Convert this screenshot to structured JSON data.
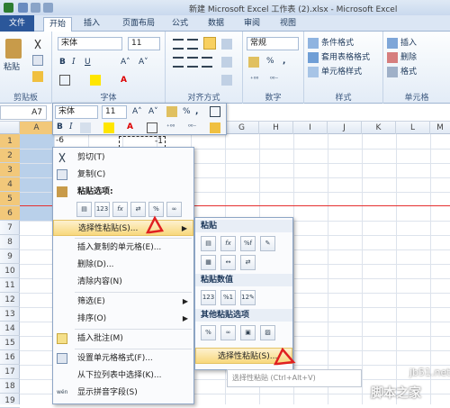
{
  "title": "新建 Microsoft Excel 工作表 (2).xlsx - Microsoft Excel",
  "tabs": {
    "file": "文件",
    "home": "开始",
    "insert": "插入",
    "layout": "页面布局",
    "formula": "公式",
    "data": "数据",
    "review": "审阅",
    "view": "视图"
  },
  "ribbon": {
    "paste_label": "粘贴",
    "clipboard_label": "剪贴板",
    "font_name": "宋体",
    "font_size": "11",
    "font_group_label": "字体",
    "align_group_label": "对齐方式",
    "number_format": "常规",
    "number_group_label": "数字",
    "cond_format": "条件格式",
    "table_format": "套用表格格式",
    "cell_style": "单元格样式",
    "style_group_label": "样式",
    "insert": "插入",
    "delete": "删除",
    "format": "格式",
    "cells_group_label": "单元格",
    "number_percent": "%",
    "number_comma": ","
  },
  "namebox": "A7",
  "columns": [
    "A",
    "B",
    "C",
    "D",
    "E",
    "F",
    "G",
    "H",
    "I",
    "J",
    "K",
    "L",
    "M"
  ],
  "rows": [
    "1",
    "2",
    "3",
    "4",
    "5",
    "6",
    "7",
    "8",
    "9",
    "10",
    "11",
    "12",
    "13",
    "14",
    "15",
    "16",
    "17",
    "18",
    "19",
    "20",
    "21",
    "22"
  ],
  "cell_a1": "-6",
  "cell_c1": "-1",
  "mini_toolbar": {
    "font": "宋体",
    "size": "11"
  },
  "context_menu": {
    "cut": "剪切(T)",
    "copy": "复制(C)",
    "paste_options": "粘贴选项:",
    "paste_special": "选择性粘贴(S)...",
    "insert_copied": "插入复制的单元格(E)...",
    "delete": "删除(D)...",
    "clear": "清除内容(N)",
    "filter": "筛选(E)",
    "sort": "排序(O)",
    "insert_comment": "插入批注(M)",
    "format_cells": "设置单元格格式(F)...",
    "pick_list": "从下拉列表中选择(K)...",
    "phonetic": "显示拼音字段(S)"
  },
  "submenu": {
    "paste_header": "粘贴",
    "values_header": "粘贴数值",
    "other_header": "其他粘贴选项",
    "paste_special": "选择性粘贴(S)..."
  },
  "tooltip": "选择性粘贴 (Ctrl+Alt+V)",
  "watermark": {
    "site": "jb51.net",
    "brand": "脚本之家"
  },
  "colors": {
    "accent": "#2b579a",
    "selection": "#b9d0ea",
    "highlight": "#f8d87c",
    "annotation": "#e02020"
  }
}
